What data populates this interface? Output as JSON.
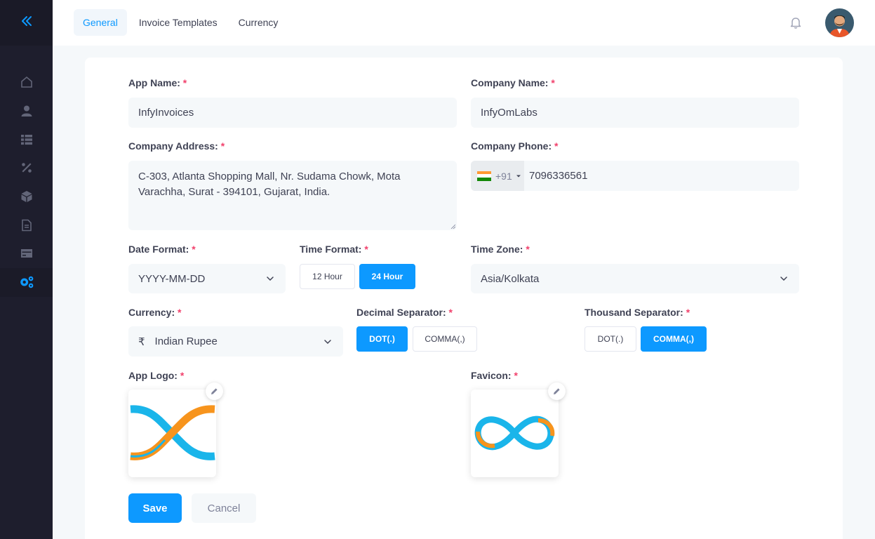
{
  "tabs": [
    "General",
    "Invoice Templates",
    "Currency"
  ],
  "sidebar": {
    "collapse_icon": "double-chevron-left-icon",
    "items": [
      {
        "icon": "home-icon"
      },
      {
        "icon": "user-icon"
      },
      {
        "icon": "list-icon"
      },
      {
        "icon": "percent-icon"
      },
      {
        "icon": "box-icon"
      },
      {
        "icon": "document-icon"
      },
      {
        "icon": "credit-card-icon"
      },
      {
        "icon": "settings-icon",
        "active": true
      }
    ]
  },
  "header": {
    "notification_icon": "bell-icon",
    "avatar_icon": "user-avatar"
  },
  "form": {
    "required_mark": "*",
    "app_name": {
      "label": "App Name:",
      "value": "InfyInvoices"
    },
    "company_name": {
      "label": "Company Name:",
      "value": "InfyOmLabs"
    },
    "company_address": {
      "label": "Company Address:",
      "value": "C-303, Atlanta Shopping Mall, Nr. Sudama Chowk, Mota Varachha, Surat - 394101, Gujarat, India."
    },
    "company_phone": {
      "label": "Company Phone:",
      "dial_code": "+91",
      "value": "7096336561"
    },
    "date_format": {
      "label": "Date Format:",
      "value": "YYYY-MM-DD"
    },
    "time_format": {
      "label": "Time Format:",
      "options": [
        "12 Hour",
        "24 Hour"
      ],
      "selected": "24 Hour"
    },
    "time_zone": {
      "label": "Time Zone:",
      "value": "Asia/Kolkata"
    },
    "currency": {
      "label": "Currency:",
      "symbol": "₹",
      "value": "Indian Rupee"
    },
    "decimal_separator": {
      "label": "Decimal Separator:",
      "options": [
        "DOT(.)",
        "COMMA(,)"
      ],
      "selected": "DOT(.)"
    },
    "thousand_separator": {
      "label": "Thousand Separator:",
      "options": [
        "DOT(.)",
        "COMMA(,)"
      ],
      "selected": "COMMA(,)"
    },
    "app_logo": {
      "label": "App Logo:"
    },
    "favicon": {
      "label": "Favicon:"
    },
    "save_label": "Save",
    "cancel_label": "Cancel"
  },
  "colors": {
    "primary": "#0d99ff",
    "sidebar": "#1e1e2d",
    "required": "#f1416c",
    "logo_blue": "#1ab5ea",
    "logo_orange": "#f7941d"
  }
}
